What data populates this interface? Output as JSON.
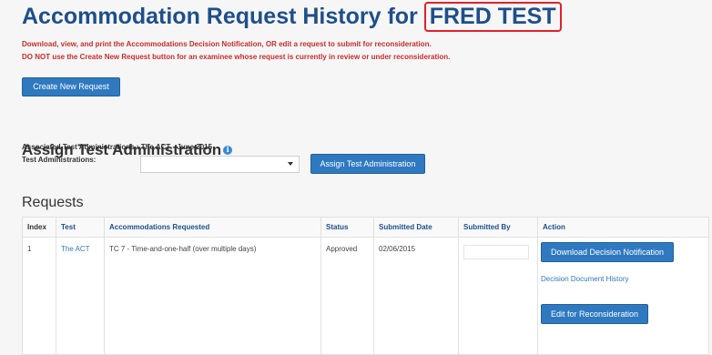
{
  "header": {
    "title_prefix": "Accommodation Request History for",
    "examinee_name": "FRED TEST",
    "warning_line1": "Download, view, and print the Accommodations Decision Notification, OR edit a request to submit for reconsideration.",
    "warning_line2": "DO NOT use the Create New Request button for an examinee whose request is currently in review or under reconsideration."
  },
  "toolbar": {
    "create_label": "Create New Request"
  },
  "assign": {
    "heading": "Assign Test Administration",
    "associated_label": "Associated Test Administrations : The ACT - June 2015",
    "admin_label": "Test Administrations:",
    "select_value": "",
    "button_label": "Assign Test Administration"
  },
  "requests": {
    "heading": "Requests",
    "columns": [
      "Index",
      "Test",
      "Accommodations Requested",
      "Status",
      "Submitted Date",
      "Submitted By",
      "Action"
    ],
    "rows": [
      {
        "index": "1",
        "test": "The ACT",
        "accommodations": "TC 7 - Time-and-one-half (over multiple days)",
        "status": "Approved",
        "submitted_date": "02/06/2015",
        "submitted_by": "",
        "actions": {
          "download": "Download Decision Notification",
          "history": "Decision Document History",
          "edit": "Edit for Reconsideration"
        }
      }
    ]
  },
  "colors": {
    "title": "#1e4f8a",
    "warning": "#c62d2d",
    "button": "#2f79c0",
    "highlight": "#e3202b"
  }
}
